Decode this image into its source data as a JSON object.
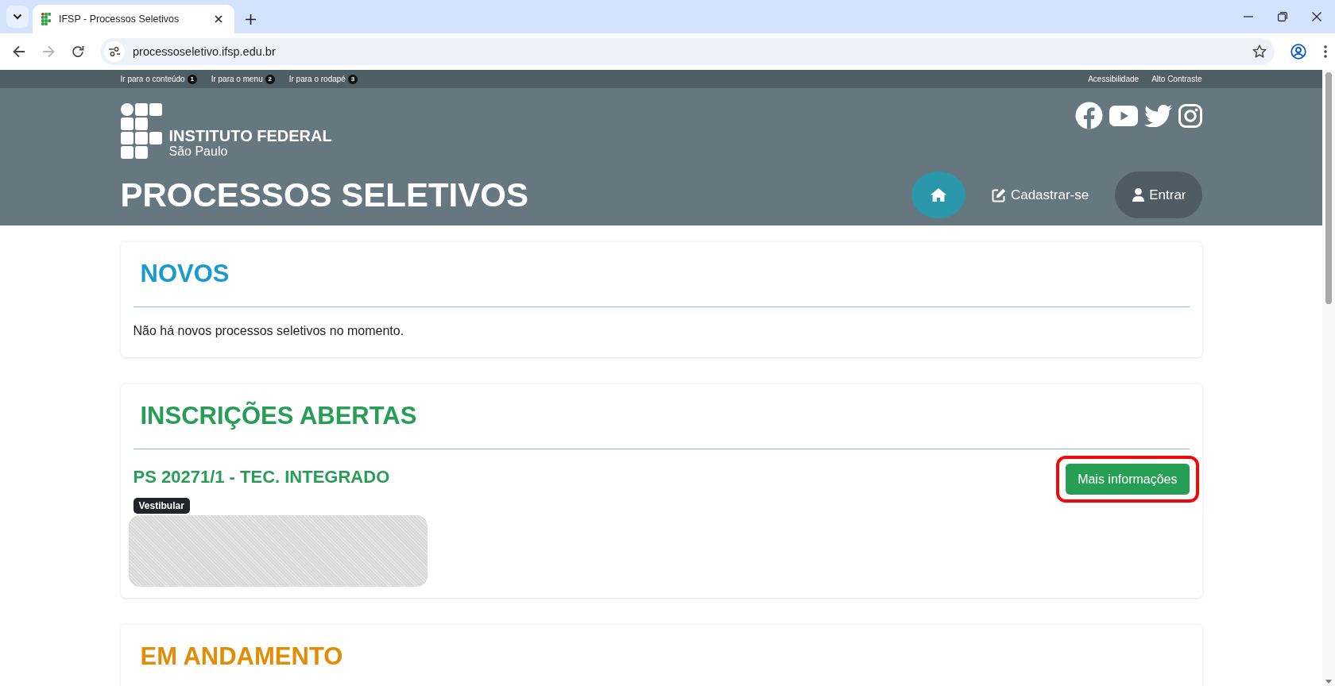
{
  "browser": {
    "tab": {
      "title": "IFSP - Processos Seletivos"
    },
    "nav_buttons": [
      {
        "kind": "back",
        "disabled": false
      },
      {
        "kind": "forward",
        "disabled": true
      },
      {
        "kind": "reload",
        "disabled": false
      }
    ],
    "url": "processoseletivo.ifsp.edu.br"
  },
  "skip_links": [
    {
      "label": "Ir para o conteúdo",
      "key": "1"
    },
    {
      "label": "Ir para o menu",
      "key": "2"
    },
    {
      "label": "Ir para o rodapé",
      "key": "3"
    }
  ],
  "accessibility_links": [
    "Acessibilidade",
    "Alto Contraste"
  ],
  "logo": {
    "name": "INSTITUTO FEDERAL",
    "campus": "São Paulo"
  },
  "page_title": "PROCESSOS SELETIVOS",
  "nav": [
    {
      "kind": "home"
    },
    {
      "kind": "link",
      "label": "Cadastrar-se"
    },
    {
      "kind": "button",
      "label": "Entrar"
    }
  ],
  "sections": [
    {
      "title": "NOVOS",
      "color": "#1b9ad0",
      "message": "Não há novos processos seletivos no momento."
    },
    {
      "title": "INSCRIÇÕES ABERTAS",
      "color": "#279e55",
      "processes": [
        {
          "title": "PS 20271/1 - TEC. INTEGRADO",
          "badge": "Vestibular",
          "details_redacted": true,
          "button": {
            "label": "Mais informações",
            "highlighted": true
          }
        }
      ]
    },
    {
      "title": "EM ANDAMENTO",
      "color": "#e38d07"
    }
  ]
}
